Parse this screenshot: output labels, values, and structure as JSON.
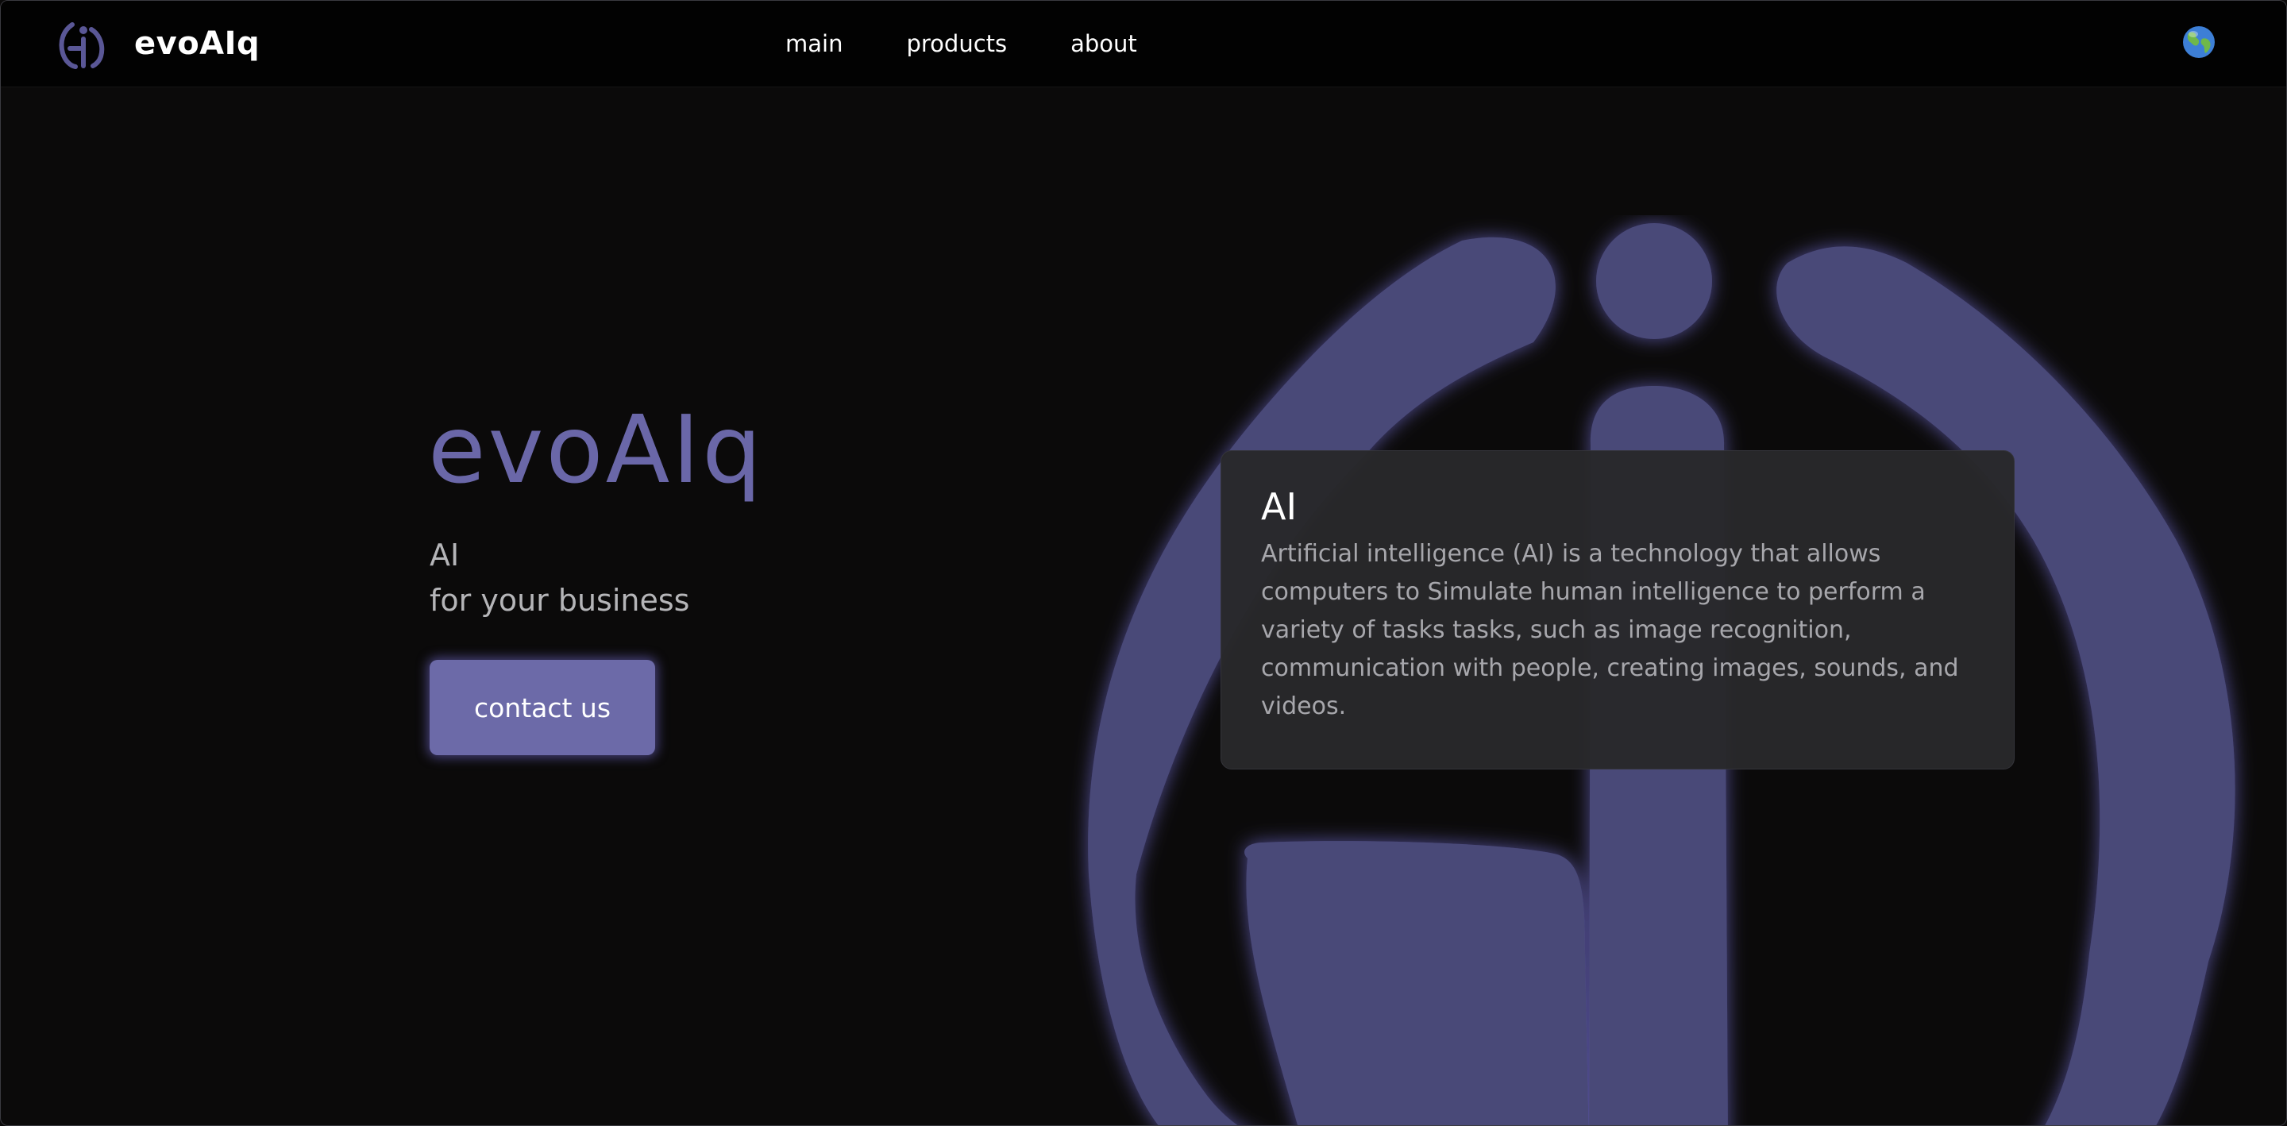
{
  "header": {
    "brand_name": "evoAIq",
    "logo_icon": "evoaiq-logo-icon",
    "nav": [
      {
        "label": "main"
      },
      {
        "label": "products"
      },
      {
        "label": "about"
      }
    ],
    "language_icon": "globe-icon"
  },
  "hero": {
    "title": "evoAIq",
    "subtitle_line1": "AI",
    "subtitle_line2": "for your business",
    "cta_label": "contact us",
    "background_icon": "evoaiq-logo-large-icon"
  },
  "info_card": {
    "title": "AI",
    "text": "Artificial intelligence (AI) is a technology that allows computers to Simulate human intelligence to perform a variety of tasks tasks, such as image recognition, communication with people, creating images, sounds, and videos."
  },
  "colors": {
    "accent": "#6c6aa8",
    "logo_fill": "#4a4878",
    "background": "#0b0a0a",
    "header_background": "#020202",
    "card_background": "#28282a"
  }
}
